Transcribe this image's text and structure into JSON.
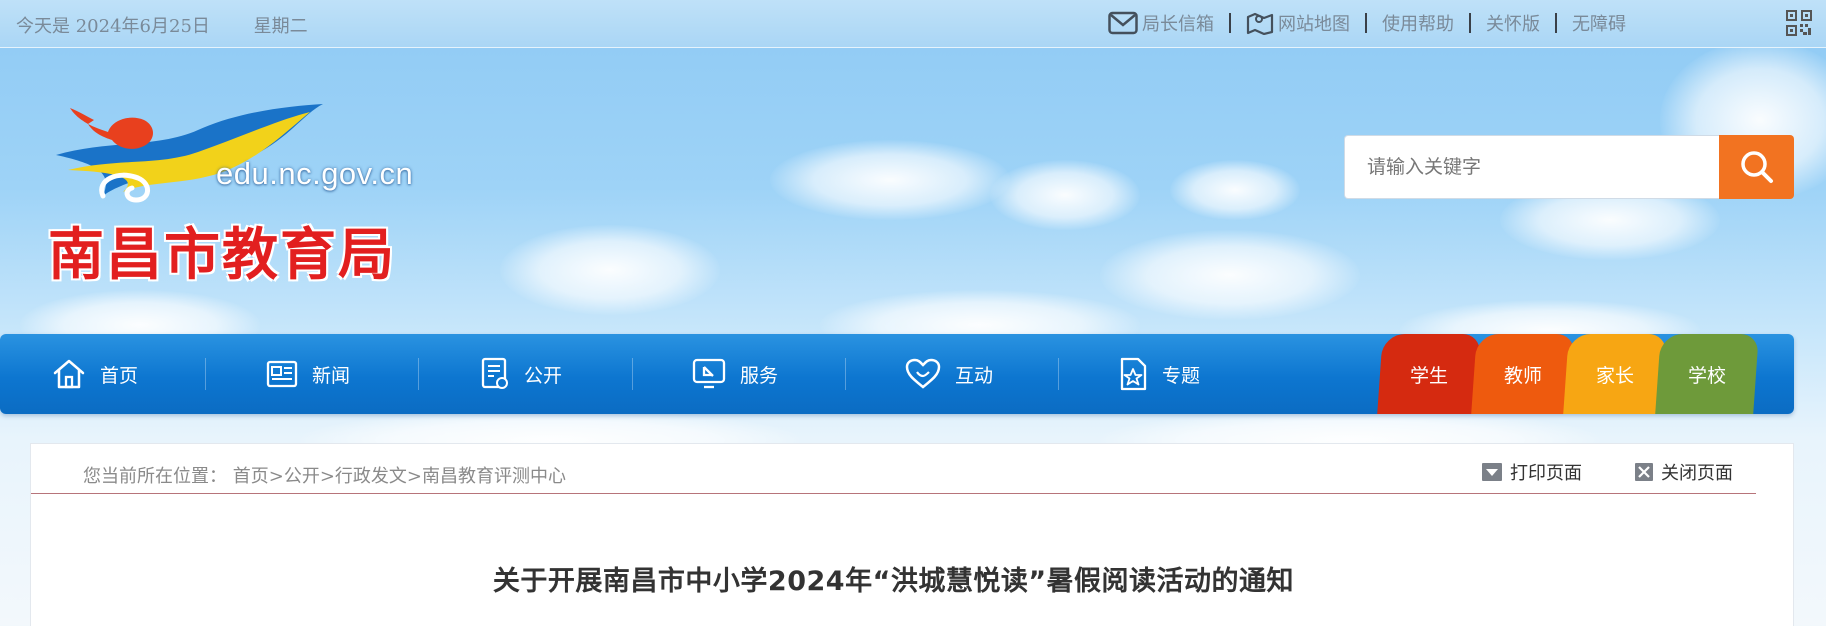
{
  "topbar": {
    "date_prefix": "今天是",
    "date": "2024年6月25日",
    "weekday": "星期二",
    "links": [
      {
        "label": "局长信箱",
        "icon": "mail-icon"
      },
      {
        "label": "网站地图",
        "icon": "map-icon"
      },
      {
        "label": "使用帮助",
        "icon": ""
      },
      {
        "label": "关怀版",
        "icon": ""
      },
      {
        "label": "无障碍",
        "icon": ""
      }
    ],
    "qr_icon": "qr-code-icon"
  },
  "logo": {
    "domain": "edu.nc.gov.cn",
    "name": "南昌市教育局"
  },
  "search": {
    "placeholder": "请输入关键字",
    "button_icon": "search-icon"
  },
  "nav": {
    "items": [
      {
        "label": "首页",
        "icon": "home-icon"
      },
      {
        "label": "新闻",
        "icon": "news-icon"
      },
      {
        "label": "公开",
        "icon": "document-icon"
      },
      {
        "label": "服务",
        "icon": "service-icon"
      },
      {
        "label": "互动",
        "icon": "heart-icon"
      },
      {
        "label": "专题",
        "icon": "topic-icon"
      }
    ],
    "roles": [
      {
        "label": "学生",
        "color": "#d52a10"
      },
      {
        "label": "教师",
        "color": "#ee5a0e"
      },
      {
        "label": "家长",
        "color": "#f7a613"
      },
      {
        "label": "学校",
        "color": "#6e9a3a"
      }
    ]
  },
  "breadcrumb": {
    "prefix": "您当前所在位置：",
    "items": [
      "首页",
      "公开",
      "行政发文",
      "南昌教育评测中心"
    ],
    "separator": ">"
  },
  "actions": {
    "print": "打印页面",
    "close": "关闭页面"
  },
  "article": {
    "title": "关于开展南昌市中小学2024年“洪城慧悦读”暑假阅读活动的通知"
  },
  "colors": {
    "nav_blue": "#0d76d0",
    "search_orange": "#f27321",
    "logo_red": "#e21f1f"
  }
}
